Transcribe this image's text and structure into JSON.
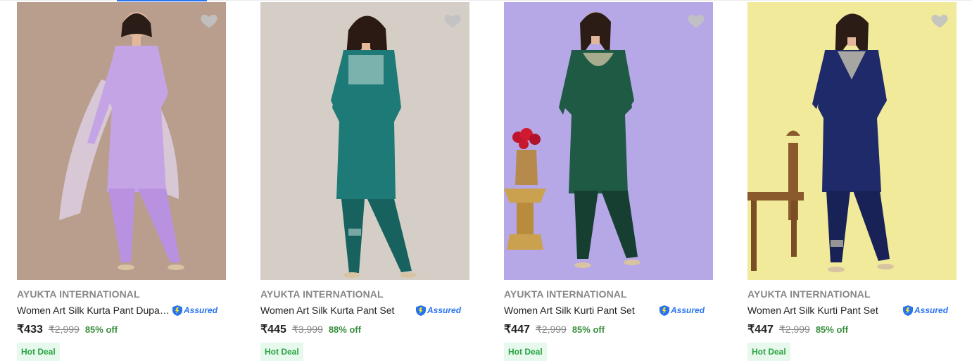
{
  "products": [
    {
      "brand": "AYUKTA INTERNATIONAL",
      "title": "Women Art Silk Kurta Pant Dupat...",
      "assured": "Assured",
      "price": "₹433",
      "mrp": "₹2,999",
      "discount": "85% off",
      "badge": "Hot Deal",
      "bg": "#b99e8d",
      "outfit": "#c5a4e6",
      "trim": "#e0d0f2"
    },
    {
      "brand": "AYUKTA INTERNATIONAL",
      "title": "Women Art Silk Kurta Pant Set",
      "assured": "Assured",
      "price": "₹445",
      "mrp": "₹3,999",
      "discount": "88% off",
      "badge": "Hot Deal",
      "bg": "#d9d3cb",
      "outfit": "#1e7a76",
      "trim": "#b9d7d2"
    },
    {
      "brand": "AYUKTA INTERNATIONAL",
      "title": "Women Art Silk Kurti Pant Set",
      "assured": "Assured",
      "price": "₹447",
      "mrp": "₹2,999",
      "discount": "85% off",
      "badge": "Hot Deal",
      "bg": "#b6a7e6",
      "outfit": "#1f5a45",
      "trim": "#c9c0a0"
    },
    {
      "brand": "AYUKTA INTERNATIONAL",
      "title": "Women Art Silk Kurti Pant Set",
      "assured": "Assured",
      "price": "₹447",
      "mrp": "₹2,999",
      "discount": "85% off",
      "badge": "Hot Deal",
      "bg": "#f1ea9a",
      "outfit": "#1f2a6a",
      "trim": "#c9c6b0"
    }
  ],
  "colors": {
    "accent": "#2874f0",
    "discount": "#388e3c",
    "badge_bg": "#e7f8ec",
    "badge_text": "#26a541"
  },
  "icons": {
    "wishlist": "heart-icon",
    "assured": "flipkart-assured-icon"
  }
}
